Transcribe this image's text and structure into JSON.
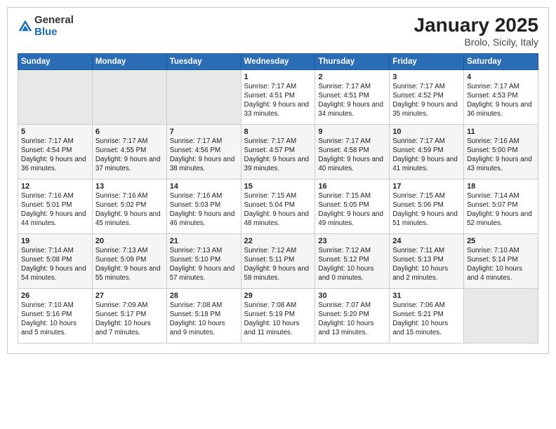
{
  "logo": {
    "general": "General",
    "blue": "Blue"
  },
  "title": "January 2025",
  "subtitle": "Brolo, Sicily, Italy",
  "days_of_week": [
    "Sunday",
    "Monday",
    "Tuesday",
    "Wednesday",
    "Thursday",
    "Friday",
    "Saturday"
  ],
  "weeks": [
    [
      {
        "day": "",
        "info": ""
      },
      {
        "day": "",
        "info": ""
      },
      {
        "day": "",
        "info": ""
      },
      {
        "day": "1",
        "info": "Sunrise: 7:17 AM\nSunset: 4:51 PM\nDaylight: 9 hours and 33 minutes."
      },
      {
        "day": "2",
        "info": "Sunrise: 7:17 AM\nSunset: 4:51 PM\nDaylight: 9 hours and 34 minutes."
      },
      {
        "day": "3",
        "info": "Sunrise: 7:17 AM\nSunset: 4:52 PM\nDaylight: 9 hours and 35 minutes."
      },
      {
        "day": "4",
        "info": "Sunrise: 7:17 AM\nSunset: 4:53 PM\nDaylight: 9 hours and 36 minutes."
      }
    ],
    [
      {
        "day": "5",
        "info": "Sunrise: 7:17 AM\nSunset: 4:54 PM\nDaylight: 9 hours and 36 minutes."
      },
      {
        "day": "6",
        "info": "Sunrise: 7:17 AM\nSunset: 4:55 PM\nDaylight: 9 hours and 37 minutes."
      },
      {
        "day": "7",
        "info": "Sunrise: 7:17 AM\nSunset: 4:56 PM\nDaylight: 9 hours and 38 minutes."
      },
      {
        "day": "8",
        "info": "Sunrise: 7:17 AM\nSunset: 4:57 PM\nDaylight: 9 hours and 39 minutes."
      },
      {
        "day": "9",
        "info": "Sunrise: 7:17 AM\nSunset: 4:58 PM\nDaylight: 9 hours and 40 minutes."
      },
      {
        "day": "10",
        "info": "Sunrise: 7:17 AM\nSunset: 4:59 PM\nDaylight: 9 hours and 41 minutes."
      },
      {
        "day": "11",
        "info": "Sunrise: 7:16 AM\nSunset: 5:00 PM\nDaylight: 9 hours and 43 minutes."
      }
    ],
    [
      {
        "day": "12",
        "info": "Sunrise: 7:16 AM\nSunset: 5:01 PM\nDaylight: 9 hours and 44 minutes."
      },
      {
        "day": "13",
        "info": "Sunrise: 7:16 AM\nSunset: 5:02 PM\nDaylight: 9 hours and 45 minutes."
      },
      {
        "day": "14",
        "info": "Sunrise: 7:16 AM\nSunset: 5:03 PM\nDaylight: 9 hours and 46 minutes."
      },
      {
        "day": "15",
        "info": "Sunrise: 7:15 AM\nSunset: 5:04 PM\nDaylight: 9 hours and 48 minutes."
      },
      {
        "day": "16",
        "info": "Sunrise: 7:15 AM\nSunset: 5:05 PM\nDaylight: 9 hours and 49 minutes."
      },
      {
        "day": "17",
        "info": "Sunrise: 7:15 AM\nSunset: 5:06 PM\nDaylight: 9 hours and 51 minutes."
      },
      {
        "day": "18",
        "info": "Sunrise: 7:14 AM\nSunset: 5:07 PM\nDaylight: 9 hours and 52 minutes."
      }
    ],
    [
      {
        "day": "19",
        "info": "Sunrise: 7:14 AM\nSunset: 5:08 PM\nDaylight: 9 hours and 54 minutes."
      },
      {
        "day": "20",
        "info": "Sunrise: 7:13 AM\nSunset: 5:09 PM\nDaylight: 9 hours and 55 minutes."
      },
      {
        "day": "21",
        "info": "Sunrise: 7:13 AM\nSunset: 5:10 PM\nDaylight: 9 hours and 57 minutes."
      },
      {
        "day": "22",
        "info": "Sunrise: 7:12 AM\nSunset: 5:11 PM\nDaylight: 9 hours and 58 minutes."
      },
      {
        "day": "23",
        "info": "Sunrise: 7:12 AM\nSunset: 5:12 PM\nDaylight: 10 hours and 0 minutes."
      },
      {
        "day": "24",
        "info": "Sunrise: 7:11 AM\nSunset: 5:13 PM\nDaylight: 10 hours and 2 minutes."
      },
      {
        "day": "25",
        "info": "Sunrise: 7:10 AM\nSunset: 5:14 PM\nDaylight: 10 hours and 4 minutes."
      }
    ],
    [
      {
        "day": "26",
        "info": "Sunrise: 7:10 AM\nSunset: 5:16 PM\nDaylight: 10 hours and 5 minutes."
      },
      {
        "day": "27",
        "info": "Sunrise: 7:09 AM\nSunset: 5:17 PM\nDaylight: 10 hours and 7 minutes."
      },
      {
        "day": "28",
        "info": "Sunrise: 7:08 AM\nSunset: 5:18 PM\nDaylight: 10 hours and 9 minutes."
      },
      {
        "day": "29",
        "info": "Sunrise: 7:08 AM\nSunset: 5:19 PM\nDaylight: 10 hours and 11 minutes."
      },
      {
        "day": "30",
        "info": "Sunrise: 7:07 AM\nSunset: 5:20 PM\nDaylight: 10 hours and 13 minutes."
      },
      {
        "day": "31",
        "info": "Sunrise: 7:06 AM\nSunset: 5:21 PM\nDaylight: 10 hours and 15 minutes."
      },
      {
        "day": "",
        "info": ""
      }
    ]
  ]
}
